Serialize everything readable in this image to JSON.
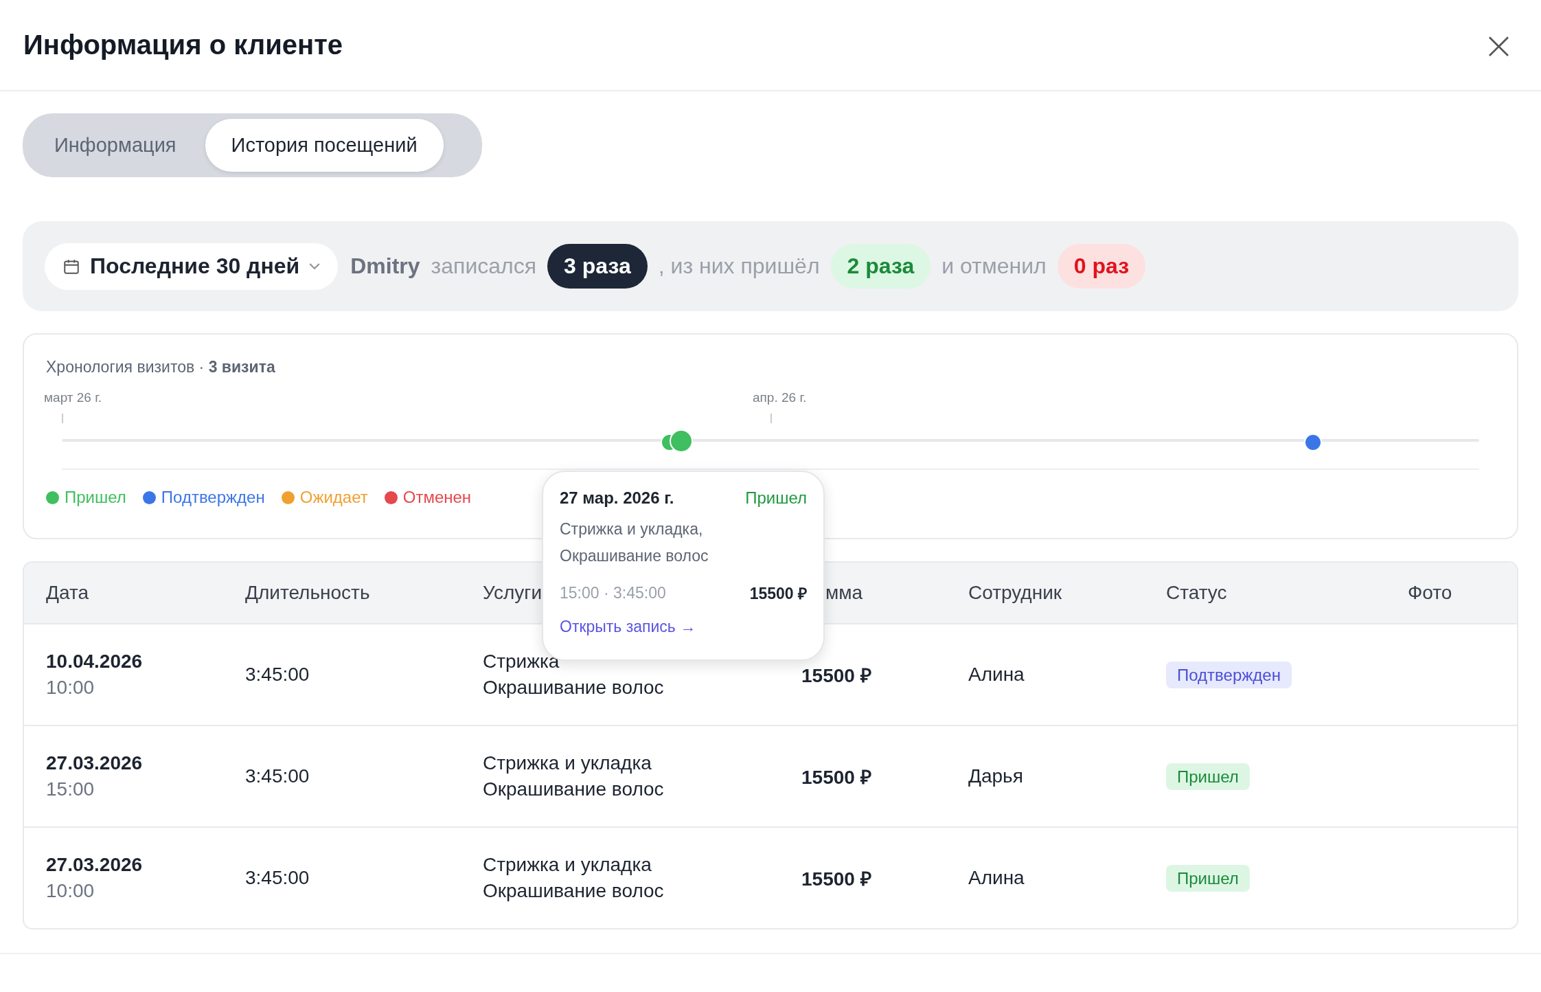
{
  "window": {
    "title": "Информация о клиенте",
    "close": "×"
  },
  "tabs": [
    {
      "label": "Информация",
      "selected": false
    },
    {
      "label": "История посещений",
      "selected": true
    }
  ],
  "summary": {
    "period": "Последние 30 дней",
    "client": "Dmitry",
    "booked_text": "записался",
    "booked": "3 раза",
    "came_text": ", из них пришёл",
    "came": "2 раза",
    "cancel_text": "и отменил",
    "cancelled": "0 раз"
  },
  "timeline": {
    "title": "Хронология визитов · **3 визита**",
    "ticks": [
      "март 26 г.",
      "апр. 26 г."
    ],
    "points": [
      {
        "kind": "arrived",
        "selected": false
      },
      {
        "kind": "arrived",
        "selected": true
      },
      {
        "kind": "confirmed",
        "selected": false
      }
    ],
    "legend": [
      {
        "label": "Пришел",
        "color": "#3fbf5f"
      },
      {
        "label": "Подтвержден",
        "color": "#3b76e8"
      },
      {
        "label": "Ожидает",
        "color": "#f0a030"
      },
      {
        "label": "Отменен",
        "color": "#e5484d"
      }
    ]
  },
  "tooltip": {
    "date": "27 мар. 2026 г.",
    "status": "Пришел",
    "services": [
      "Стрижка и укладка,",
      "Окрашивание волос"
    ],
    "time": "15:00 · 3:45:00",
    "sum": "15500 ₽",
    "link": "Открыть запись →"
  },
  "table": {
    "columns": [
      "Дата",
      "Длительность",
      "Услуги",
      "мма",
      "Сотрудник",
      "Статус",
      "Фото"
    ],
    "rows": [
      {
        "date": "10.04.2026",
        "time": "10:00",
        "duration": "3:45:00",
        "services": [
          "Стрижка",
          "Окрашивание волос"
        ],
        "sum": "15500 ₽",
        "employee": "Алина",
        "status": "Подтвержден",
        "kind": "confirmed"
      },
      {
        "date": "27.03.2026",
        "time": "15:00",
        "duration": "3:45:00",
        "services": [
          "Стрижка и укладка",
          "Окрашивание волос"
        ],
        "sum": "15500 ₽",
        "employee": "Дарья",
        "status": "Пришел",
        "kind": "arrived"
      },
      {
        "date": "27.03.2026",
        "time": "10:00",
        "duration": "3:45:00",
        "services": [
          "Стрижка и укладка",
          "Окрашивание волос"
        ],
        "sum": "15500 ₽",
        "employee": "Алина",
        "status": "Пришел",
        "kind": "arrived"
      }
    ]
  }
}
